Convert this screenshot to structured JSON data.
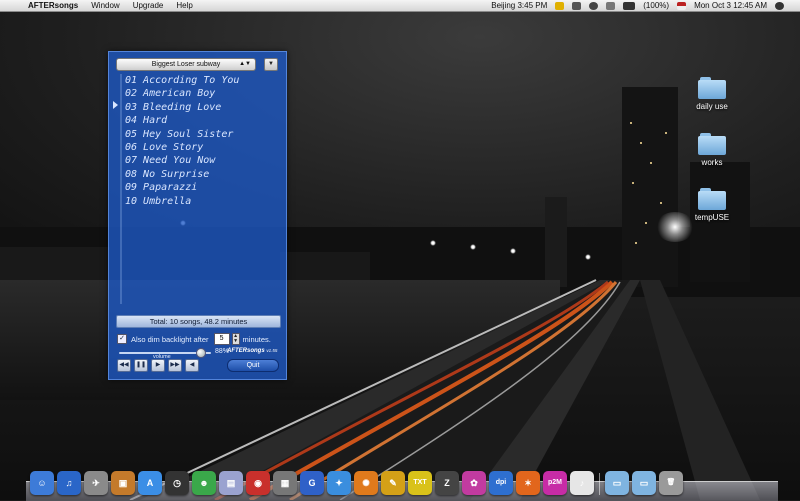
{
  "menubar": {
    "app_name": "AFTERsongs",
    "menus": [
      "Window",
      "Upgrade",
      "Help"
    ],
    "clock_city": "Beijing 3:45 PM",
    "battery": "(100%)",
    "date_time": "Mon Oct 3  12:45 AM"
  },
  "player": {
    "playlist": "Biggest Loser subway",
    "tracks": [
      "01 According To You",
      "02 American Boy",
      "03 Bleeding Love",
      "04 Hard",
      "05 Hey Soul Sister",
      "06 Love Story",
      "07 Need You Now",
      "08 No Surprise",
      "09 Paparazzi",
      "10 Umbrella"
    ],
    "now_playing_index": 2,
    "total": "Total: 10 songs, 48.2 minutes",
    "dim_label": "Also dim backlight after",
    "dim_minutes": "5",
    "dim_unit": "minutes.",
    "dim_checked": true,
    "volume_label": "volume",
    "volume_percent": "88%",
    "volume_level": 0.88,
    "brand": "AFTERsongs",
    "version": "v1.55",
    "quit_label": "Quit"
  },
  "desktop": {
    "folders": [
      {
        "label": "daily use"
      },
      {
        "label": "works"
      },
      {
        "label": "tempUSE"
      }
    ]
  },
  "dock": {
    "apps": [
      {
        "name": "finder-icon",
        "glyph": "☺",
        "color": "#3d7bd8"
      },
      {
        "name": "itunes-icon",
        "glyph": "♫",
        "color": "#2a66c8"
      },
      {
        "name": "rocket-icon",
        "glyph": "✈",
        "color": "#8a8a8a"
      },
      {
        "name": "photo-icon",
        "glyph": "▣",
        "color": "#c47a2b"
      },
      {
        "name": "appstore-icon",
        "glyph": "A",
        "color": "#3b8ee6"
      },
      {
        "name": "dashboard-icon",
        "glyph": "◷",
        "color": "#333333"
      },
      {
        "name": "messenger-icon",
        "glyph": "☻",
        "color": "#3aa84a"
      },
      {
        "name": "calendar-icon",
        "glyph": "▤",
        "color": "#9aa2d0"
      },
      {
        "name": "chrome-icon",
        "glyph": "◉",
        "color": "#c9302c"
      },
      {
        "name": "preview-icon",
        "glyph": "▦",
        "color": "#777777"
      },
      {
        "name": "google-earth-icon",
        "glyph": "G",
        "color": "#2f61c8"
      },
      {
        "name": "safari-icon",
        "glyph": "✦",
        "color": "#3a8ede"
      },
      {
        "name": "firefox-icon",
        "glyph": "✺",
        "color": "#e07a1c"
      },
      {
        "name": "pen-icon",
        "glyph": "✎",
        "color": "#d4a017"
      },
      {
        "name": "txt-icon",
        "glyph": "TXT",
        "color": "#d9c21a"
      },
      {
        "name": "z-icon",
        "glyph": "Z",
        "color": "#444444"
      },
      {
        "name": "paint-icon",
        "glyph": "✿",
        "color": "#c23ba0"
      },
      {
        "name": "dpi-icon",
        "glyph": "dpi",
        "color": "#2e6fd0"
      },
      {
        "name": "flame-icon",
        "glyph": "✶",
        "color": "#e2661c"
      },
      {
        "name": "p2m-icon",
        "glyph": "p2M",
        "color": "#c72ca6"
      },
      {
        "name": "music-note-icon",
        "glyph": "♪",
        "color": "#e6e6e6"
      }
    ],
    "stack_items": [
      {
        "name": "folder-stack-icon",
        "glyph": "▭",
        "color": "#7fb4e0"
      },
      {
        "name": "downloads-stack-icon",
        "glyph": "▭",
        "color": "#7fb4e0"
      },
      {
        "name": "trash-icon",
        "glyph": "🗑",
        "color": "#9a9a9a"
      }
    ]
  }
}
